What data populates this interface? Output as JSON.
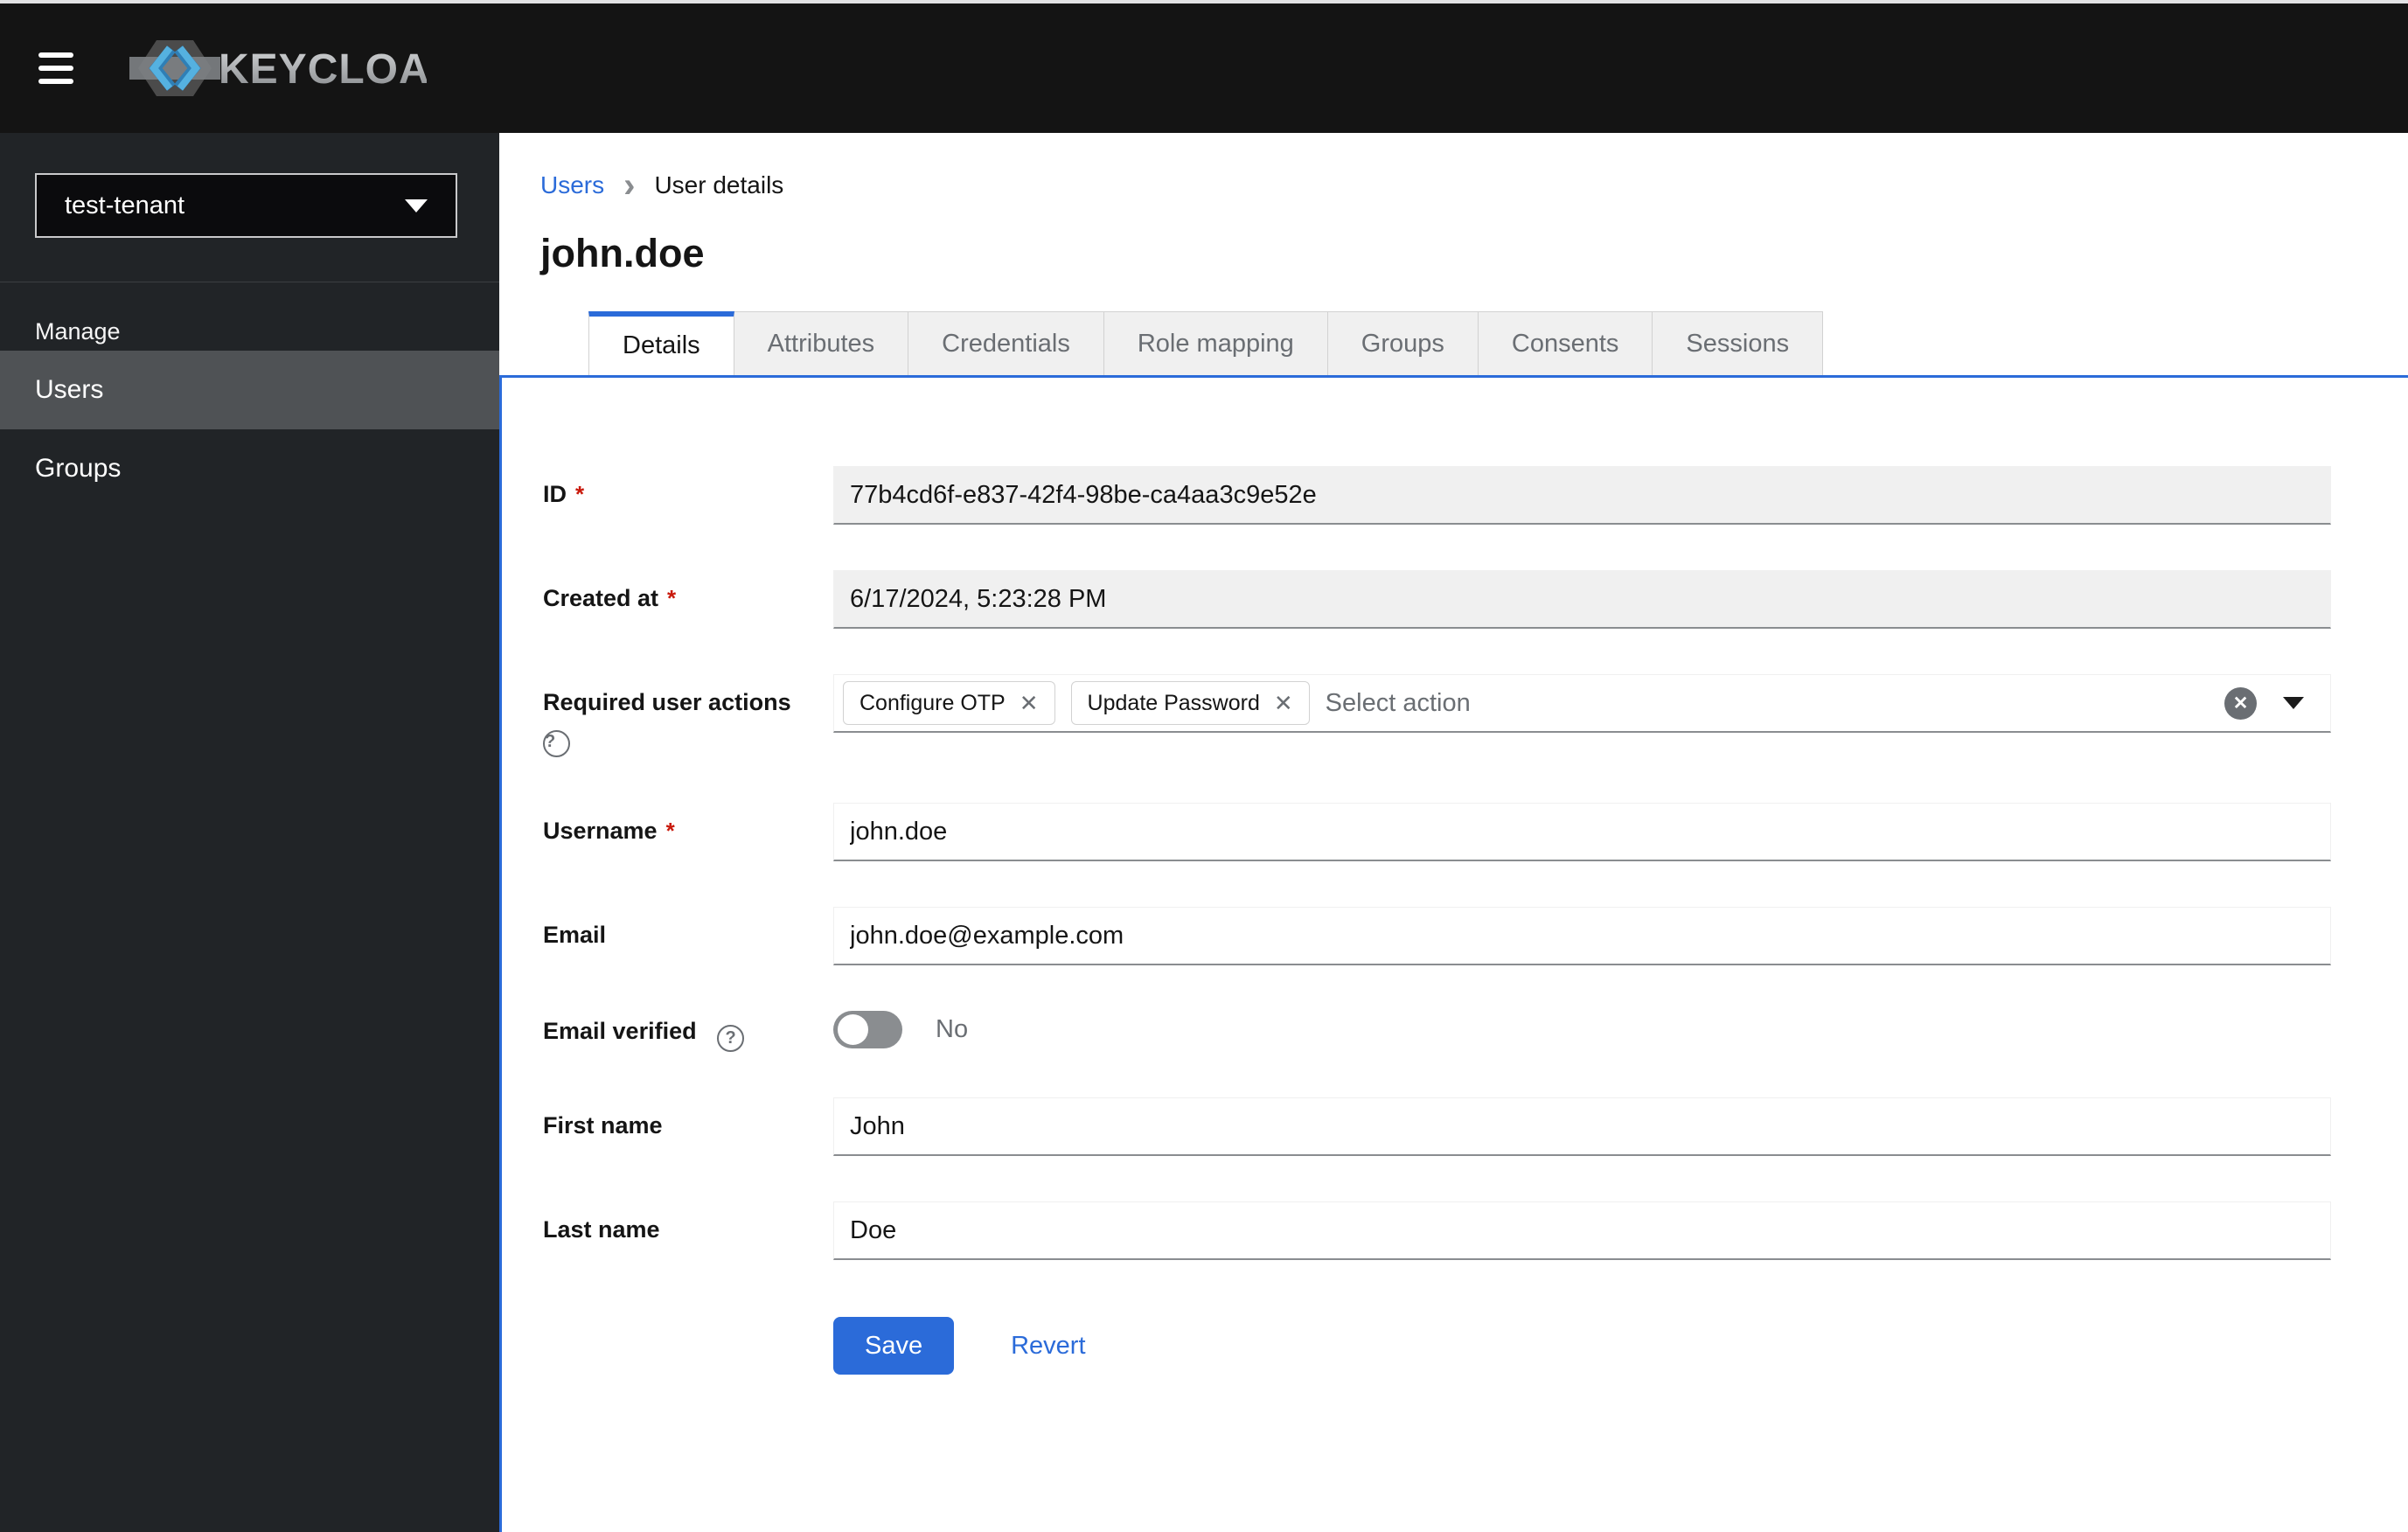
{
  "colors": {
    "accent_blue": "#2b6bd9",
    "danger_red": "#c9190b",
    "masthead_bg": "#141414",
    "sidebar_bg": "#212427",
    "sidebar_active_bg": "#4f5255",
    "disabled_field_bg": "#f0f0f0",
    "field_underline": "#8a8d90"
  },
  "icons": {
    "breadcrumb_chevron": "›",
    "chip_close": "✕",
    "clear_x": "✕",
    "help": "?"
  },
  "header": {
    "brand": "KEYCLOAK"
  },
  "sidebar": {
    "realm": "test-tenant",
    "section_title": "Manage",
    "items": [
      {
        "label": "Users",
        "active": true
      },
      {
        "label": "Groups",
        "active": false
      }
    ]
  },
  "breadcrumb": {
    "parent": "Users",
    "current": "User details"
  },
  "page_title": "john.doe",
  "tabs": [
    {
      "label": "Details",
      "active": true
    },
    {
      "label": "Attributes",
      "active": false
    },
    {
      "label": "Credentials",
      "active": false
    },
    {
      "label": "Role mapping",
      "active": false
    },
    {
      "label": "Groups",
      "active": false
    },
    {
      "label": "Consents",
      "active": false
    },
    {
      "label": "Sessions",
      "active": false
    }
  ],
  "form": {
    "id": {
      "label": "ID",
      "required": "*",
      "value": "77b4cd6f-e837-42f4-98be-ca4aa3c9e52e"
    },
    "created_at": {
      "label": "Created at",
      "required": "*",
      "value": "6/17/2024, 5:23:28 PM"
    },
    "required_user_actions": {
      "label": "Required user actions",
      "chips": [
        {
          "label": "Configure OTP"
        },
        {
          "label": "Update Password"
        }
      ],
      "placeholder": "Select action"
    },
    "username": {
      "label": "Username",
      "required": "*",
      "value": "john.doe"
    },
    "email": {
      "label": "Email",
      "value": "john.doe@example.com"
    },
    "email_verified": {
      "label": "Email verified",
      "state": "No"
    },
    "first_name": {
      "label": "First name",
      "value": "John"
    },
    "last_name": {
      "label": "Last name",
      "value": "Doe"
    },
    "actions": {
      "save": "Save",
      "revert": "Revert"
    }
  }
}
